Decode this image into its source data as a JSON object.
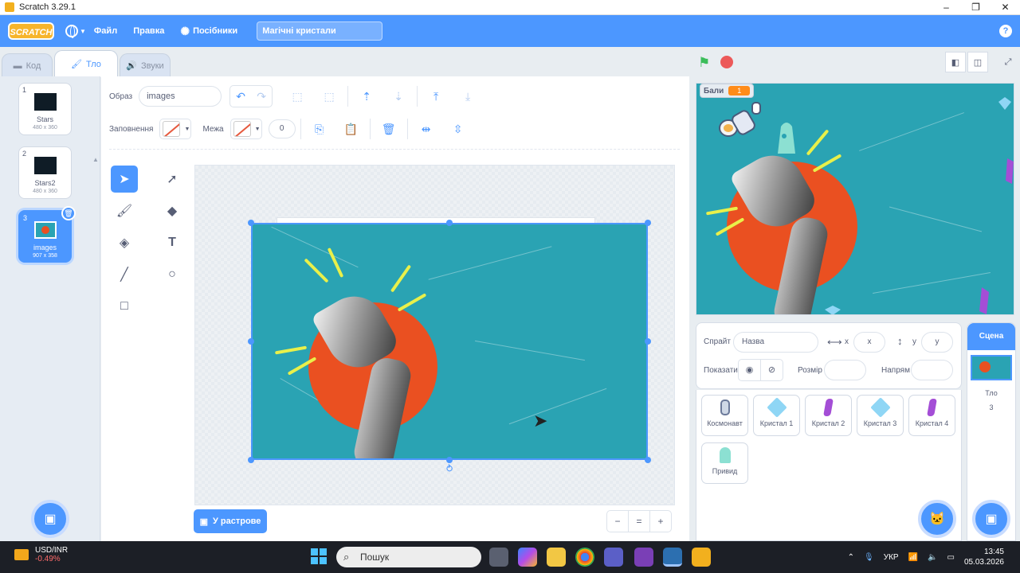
{
  "window": {
    "title": "Scratch 3.29.1",
    "controls": [
      "–",
      "❐",
      "✕"
    ]
  },
  "menubar": {
    "logo": "SCRATCH",
    "file": "Файл",
    "edit": "Правка",
    "tutorials": "Посібники",
    "project_title": "Магічні кристали",
    "help": "?"
  },
  "tabs": {
    "code": "Код",
    "backdrops": "Тло",
    "sounds": "Звуки"
  },
  "costumes": [
    {
      "num": "1",
      "name": "Stars",
      "size": "480 x 360"
    },
    {
      "num": "2",
      "name": "Stars2",
      "size": "480 x 360"
    },
    {
      "num": "3",
      "name": "images",
      "size": "907 x 358"
    }
  ],
  "paint": {
    "costume_label": "Образ",
    "costume_name": "images",
    "fill_label": "Заповнення",
    "outline_label": "Межа",
    "outline_width": "0",
    "convert_button": "У растрове",
    "zoom": {
      "out": "−",
      "reset": "=",
      "in": "+"
    }
  },
  "stage": {
    "monitor_label": "Бали",
    "monitor_value": "1"
  },
  "sprite_info": {
    "sprite_label": "Спрайт",
    "name_placeholder": "Назва",
    "x_label": "x",
    "x_placeholder": "x",
    "y_label": "y",
    "y_placeholder": "y",
    "show_label": "Показати",
    "size_label": "Розмір",
    "direction_label": "Напрям"
  },
  "sprites": [
    {
      "name": "Космонавт",
      "icon": "astronaut"
    },
    {
      "name": "Кристал 1",
      "icon": "blue-gem"
    },
    {
      "name": "Кристал 2",
      "icon": "purple-crystal"
    },
    {
      "name": "Кристал 3",
      "icon": "blue-gem"
    },
    {
      "name": "Кристал 4",
      "icon": "purple-crystal"
    },
    {
      "name": "Привид",
      "icon": "ghost"
    }
  ],
  "stage_selector": {
    "header": "Сцена",
    "backdrops_label": "Тло",
    "backdrops_count": "3"
  },
  "taskbar": {
    "ticker_name": "USD/INR",
    "ticker_delta": "-0.49%",
    "search_placeholder": "Пошук",
    "lang": "УКР",
    "time": "13:45",
    "date": "05.03.2026"
  },
  "colors": {
    "accent": "#4c97ff",
    "stage_bg": "#2aa3b3",
    "circle": "#ea5021",
    "monitor": "#ff8c1a"
  }
}
